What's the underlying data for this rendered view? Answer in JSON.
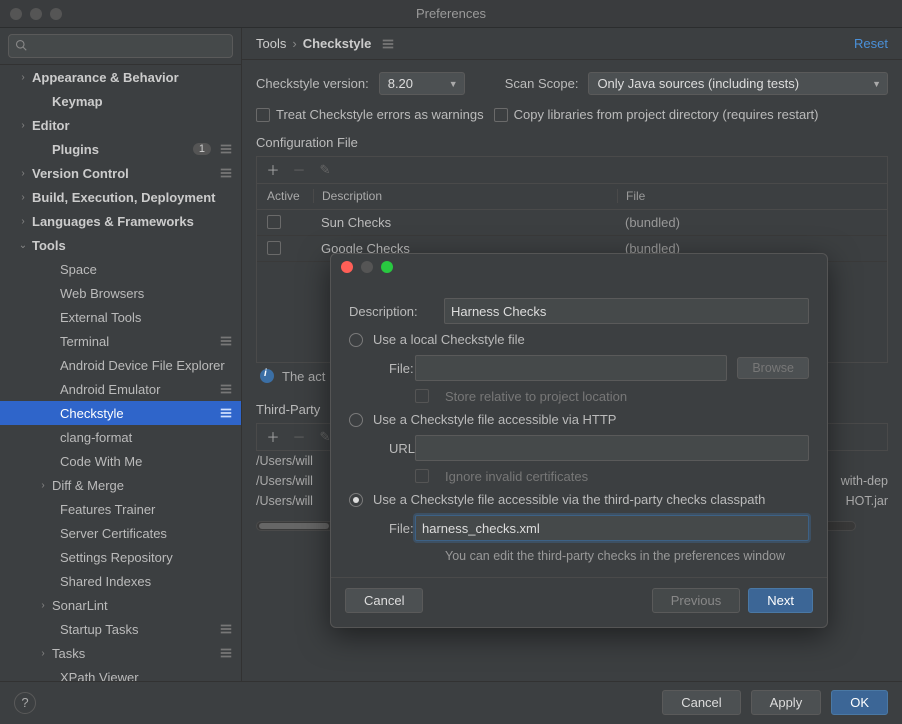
{
  "window": {
    "title": "Preferences"
  },
  "sidebar": {
    "search_placeholder": "",
    "items": [
      {
        "label": "Appearance & Behavior",
        "bold": true,
        "arrow": ">",
        "indent": 1
      },
      {
        "label": "Keymap",
        "bold": true,
        "indent": 2
      },
      {
        "label": "Editor",
        "bold": true,
        "arrow": ">",
        "indent": 1
      },
      {
        "label": "Plugins",
        "bold": true,
        "indent": 2,
        "badge": "1",
        "cfg": true
      },
      {
        "label": "Version Control",
        "bold": true,
        "arrow": ">",
        "indent": 1,
        "cfg": true
      },
      {
        "label": "Build, Execution, Deployment",
        "bold": true,
        "arrow": ">",
        "indent": 1
      },
      {
        "label": "Languages & Frameworks",
        "bold": true,
        "arrow": ">",
        "indent": 1
      },
      {
        "label": "Tools",
        "bold": true,
        "arrow": "v",
        "indent": 1
      },
      {
        "label": "Space",
        "indent": 3
      },
      {
        "label": "Web Browsers",
        "indent": 3
      },
      {
        "label": "External Tools",
        "indent": 3
      },
      {
        "label": "Terminal",
        "indent": 3,
        "cfg": true
      },
      {
        "label": "Android Device File Explorer",
        "indent": 3
      },
      {
        "label": "Android Emulator",
        "indent": 3,
        "cfg": true
      },
      {
        "label": "Checkstyle",
        "indent": 3,
        "cfg": true,
        "selected": true
      },
      {
        "label": "clang-format",
        "indent": 3
      },
      {
        "label": "Code With Me",
        "indent": 3
      },
      {
        "label": "Diff & Merge",
        "indent": 2,
        "arrow": ">"
      },
      {
        "label": "Features Trainer",
        "indent": 3
      },
      {
        "label": "Server Certificates",
        "indent": 3
      },
      {
        "label": "Settings Repository",
        "indent": 3
      },
      {
        "label": "Shared Indexes",
        "indent": 3
      },
      {
        "label": "SonarLint",
        "indent": 2,
        "arrow": ">"
      },
      {
        "label": "Startup Tasks",
        "indent": 3,
        "cfg": true
      },
      {
        "label": "Tasks",
        "indent": 2,
        "arrow": ">",
        "cfg": true
      },
      {
        "label": "XPath Viewer",
        "indent": 3
      }
    ]
  },
  "breadcrumb": {
    "root": "Tools",
    "current": "Checkstyle",
    "reset": "Reset"
  },
  "form": {
    "version_label": "Checkstyle version:",
    "version_value": "8.20",
    "scan_label": "Scan Scope:",
    "scan_value": "Only Java sources (including tests)",
    "warn_checkbox": "Treat Checkstyle errors as warnings",
    "copy_checkbox": "Copy libraries from project directory (requires restart)",
    "config_section": "Configuration File",
    "table_headers": {
      "active": "Active",
      "desc": "Description",
      "file": "File"
    },
    "rows": [
      {
        "desc": "Sun Checks",
        "file": "(bundled)"
      },
      {
        "desc": "Google Checks",
        "file": "(bundled)"
      }
    ],
    "info_text": "The act",
    "third_party_label": "Third-Party",
    "paths": [
      "/Users/will",
      "/Users/will",
      "/Users/will"
    ],
    "path_suffix_1": "with-dep",
    "path_suffix_2": "HOT.jar"
  },
  "footer": {
    "cancel": "Cancel",
    "apply": "Apply",
    "ok": "OK"
  },
  "modal": {
    "description_label": "Description:",
    "description_value": "Harness Checks",
    "option_local": "Use a local Checkstyle file",
    "local_file_label": "File:",
    "local_browse": "Browse",
    "local_store": "Store relative to project location",
    "option_http": "Use a Checkstyle file accessible via HTTP",
    "http_url_label": "URL:",
    "http_ignore": "Ignore invalid certificates",
    "option_classpath": "Use a Checkstyle file accessible via the third-party checks classpath",
    "classpath_file_label": "File:",
    "classpath_file_value": "harness_checks.xml",
    "hint": "You can edit the third-party checks in the preferences window",
    "cancel": "Cancel",
    "previous": "Previous",
    "next": "Next"
  }
}
